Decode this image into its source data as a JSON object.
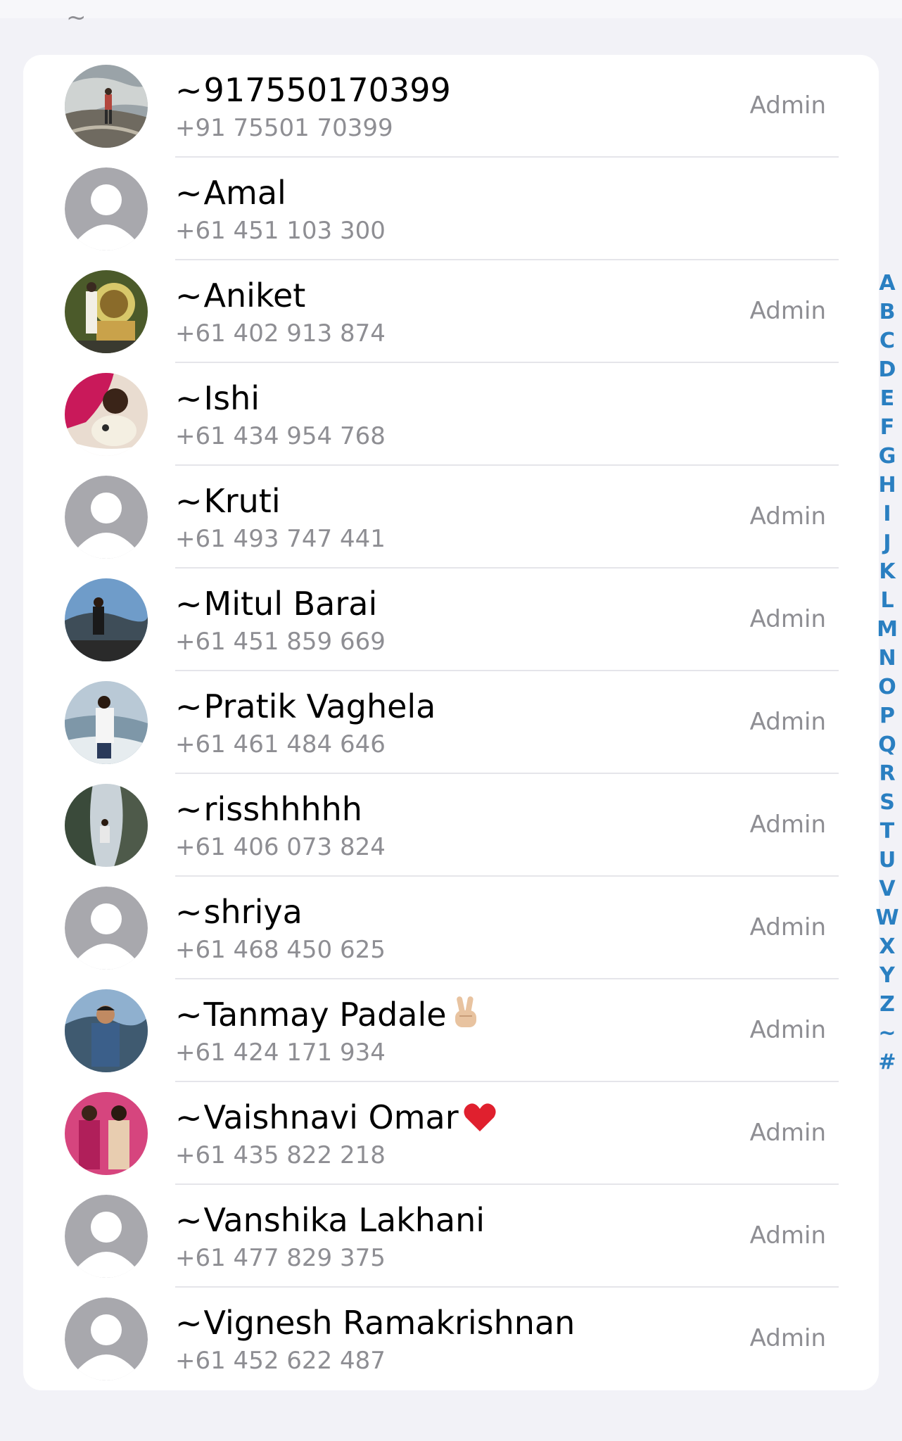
{
  "header": {
    "section_label": "~"
  },
  "members": [
    {
      "prefix": "~",
      "name": "917550170399",
      "phone": "+91 75501 70399",
      "role": "Admin",
      "avatar": "photo-rocks",
      "emoji": ""
    },
    {
      "prefix": "~",
      "name": "Amal",
      "phone": "+61 451 103 300",
      "role": "",
      "avatar": "placeholder",
      "emoji": ""
    },
    {
      "prefix": "~",
      "name": "Aniket",
      "phone": "+61 402 913 874",
      "role": "Admin",
      "avatar": "photo-shrine",
      "emoji": ""
    },
    {
      "prefix": "~",
      "name": "Ishi",
      "phone": "+61 434 954 768",
      "role": "",
      "avatar": "photo-pink",
      "emoji": ""
    },
    {
      "prefix": "~",
      "name": "Kruti",
      "phone": "+61 493 747 441",
      "role": "Admin",
      "avatar": "placeholder",
      "emoji": ""
    },
    {
      "prefix": "~",
      "name": "Mitul Barai",
      "phone": "+61 451 859 669",
      "role": "Admin",
      "avatar": "photo-mountain",
      "emoji": ""
    },
    {
      "prefix": "~",
      "name": "Pratik Vaghela",
      "phone": "+61 461 484 646",
      "role": "Admin",
      "avatar": "photo-coast",
      "emoji": ""
    },
    {
      "prefix": "~",
      "name": "risshhhhh",
      "phone": "+61 406 073 824",
      "role": "Admin",
      "avatar": "photo-cliff",
      "emoji": ""
    },
    {
      "prefix": "~",
      "name": "shriya",
      "phone": "+61 468 450 625",
      "role": "Admin",
      "avatar": "placeholder",
      "emoji": ""
    },
    {
      "prefix": "~",
      "name": "Tanmay Padale",
      "phone": "+61 424 171 934",
      "role": "Admin",
      "avatar": "photo-valley",
      "emoji": "victory-hand"
    },
    {
      "prefix": "~",
      "name": "Vaishnavi Omar",
      "phone": "+61 435 822 218",
      "role": "Admin",
      "avatar": "photo-party",
      "emoji": "red-heart"
    },
    {
      "prefix": "~",
      "name": "Vanshika Lakhani",
      "phone": "+61 477 829 375",
      "role": "Admin",
      "avatar": "placeholder",
      "emoji": ""
    },
    {
      "prefix": "~",
      "name": "Vignesh Ramakrishnan",
      "phone": "+61 452 622 487",
      "role": "Admin",
      "avatar": "placeholder",
      "emoji": ""
    }
  ],
  "index_letters": [
    "A",
    "B",
    "C",
    "D",
    "E",
    "F",
    "G",
    "H",
    "I",
    "J",
    "K",
    "L",
    "M",
    "N",
    "O",
    "P",
    "Q",
    "R",
    "S",
    "T",
    "U",
    "V",
    "W",
    "X",
    "Y",
    "Z",
    "~",
    "#"
  ],
  "colors": {
    "background": "#f2f2f7",
    "card": "#ffffff",
    "secondary_text": "#8e8e93",
    "index_accent": "#2a7fc1",
    "placeholder_avatar": "#a8a8ad"
  }
}
